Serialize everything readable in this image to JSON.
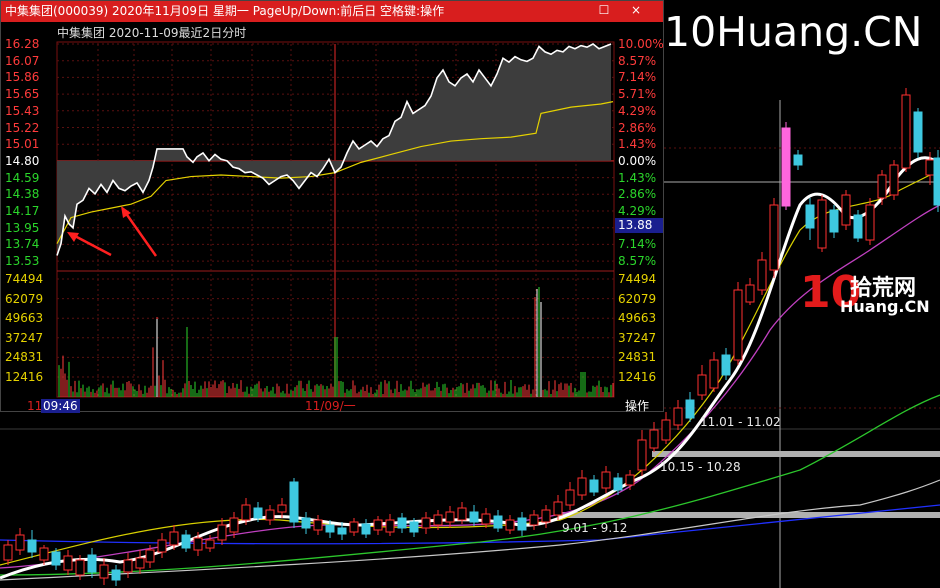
{
  "brand_watermark": "10Huang.CN",
  "annotations": {
    "range1": "11.01 - 11.02",
    "range2": "10.15 - 10.28",
    "range3": "9.01 - 9.12"
  },
  "logo": {
    "mark": "10",
    "cn_text": "拾荒网",
    "en_text": "Huang.CN"
  },
  "popup": {
    "title": "中集集团(000039) 2020年11月09日 星期一 PageUp/Down:前后日 空格键:操作",
    "subtitle": "中集集团   2020-11-09最近2日分时",
    "price_labels": [
      "16.28",
      "16.07",
      "15.86",
      "15.65",
      "15.43",
      "15.22",
      "15.01",
      "14.80",
      "14.59",
      "14.38",
      "14.17",
      "13.95",
      "13.74",
      "13.53"
    ],
    "pct_labels": [
      "10.00%",
      "8.57%",
      "7.14%",
      "5.71%",
      "4.29%",
      "2.86%",
      "1.43%",
      "0.00%",
      "1.43%",
      "2.86%",
      "4.29%",
      "5.71%",
      "7.14%",
      "8.57%"
    ],
    "volume_labels": [
      "74494",
      "62079",
      "49663",
      "37247",
      "24831",
      "12416"
    ],
    "current_price_tag": "13.88",
    "time_left": "11/",
    "time_cursor": "09:46",
    "time_mid": "11/09/一",
    "operate_label": "操作",
    "close_button": "☐",
    "close_x": "×",
    "colors": {
      "up": "#ff3b3b",
      "down": "#2bd62b",
      "title_bar": "#d81e1e",
      "avg_line": "#e5d200"
    }
  }
}
